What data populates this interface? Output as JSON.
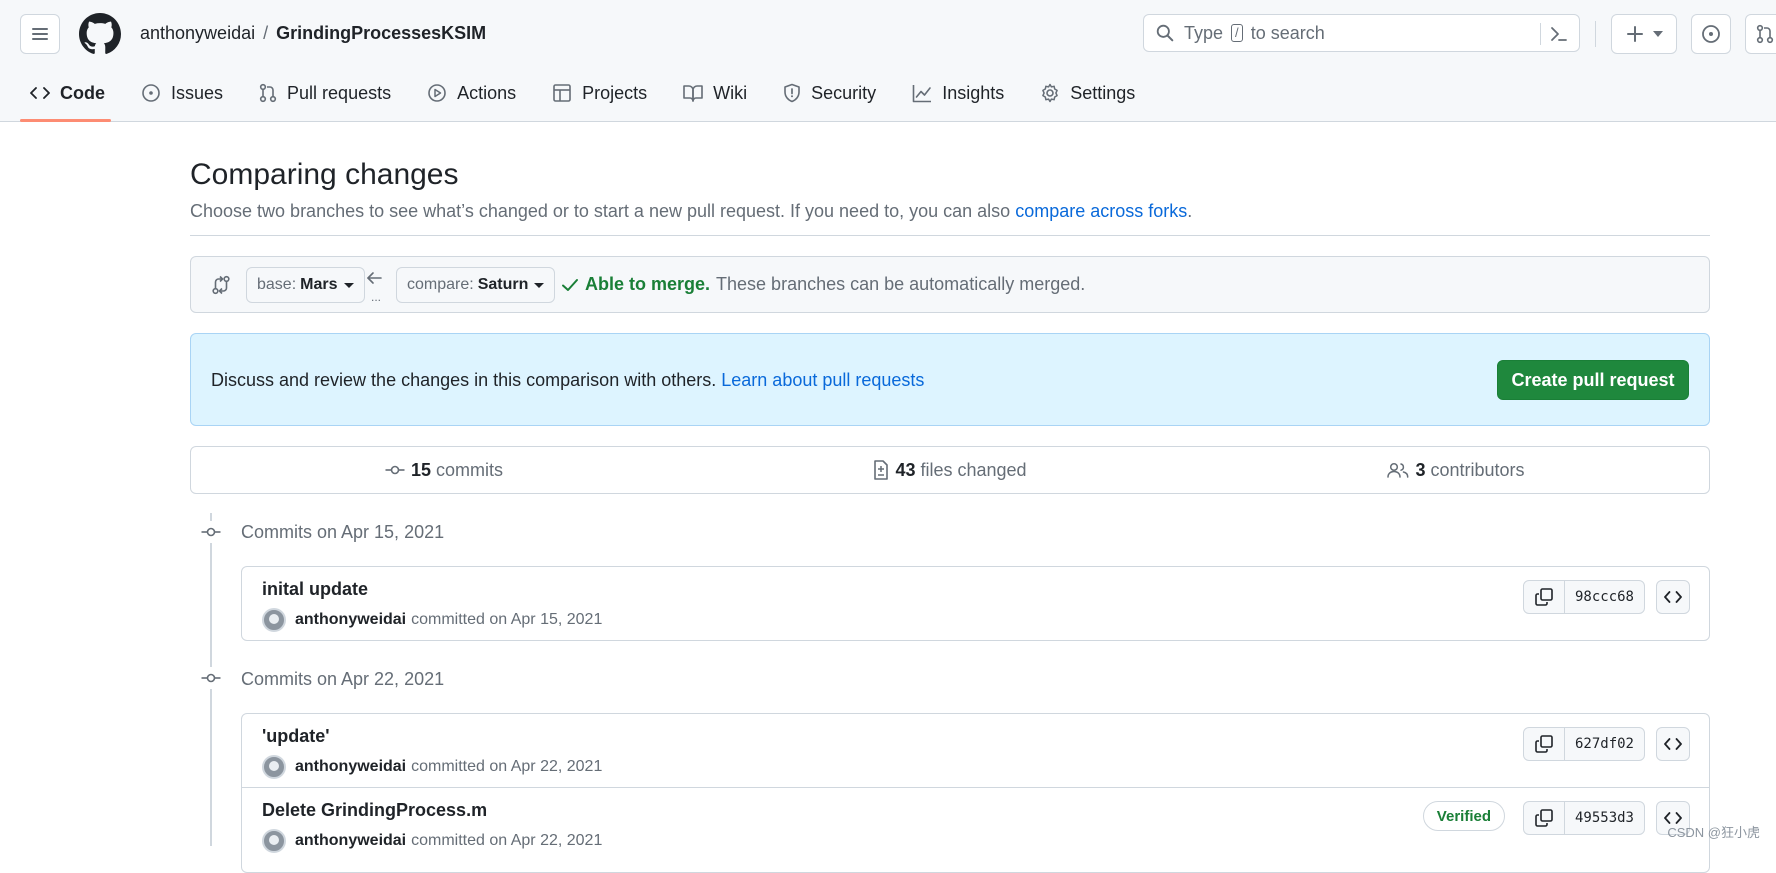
{
  "header": {
    "owner": "anthonyweidai",
    "separator": "/",
    "repo": "GrindingProcessesKSIM",
    "search_prefix": "Type",
    "search_key": "/",
    "search_suffix": "to search"
  },
  "tabs": [
    {
      "label": "Code",
      "icon": "code-icon"
    },
    {
      "label": "Issues",
      "icon": "issue-icon"
    },
    {
      "label": "Pull requests",
      "icon": "pull-request-icon"
    },
    {
      "label": "Actions",
      "icon": "play-icon"
    },
    {
      "label": "Projects",
      "icon": "table-icon"
    },
    {
      "label": "Wiki",
      "icon": "book-icon"
    },
    {
      "label": "Security",
      "icon": "shield-icon"
    },
    {
      "label": "Insights",
      "icon": "graph-icon"
    },
    {
      "label": "Settings",
      "icon": "gear-icon"
    }
  ],
  "page": {
    "title": "Comparing changes",
    "subtitle": "Choose two branches to see what’s changed or to start a new pull request. If you need to, you can also",
    "subtitle_link": "compare across forks",
    "subtitle_end": "."
  },
  "range": {
    "base_prefix": "base:",
    "base_branch": "Mars",
    "compare_prefix": "compare:",
    "compare_branch": "Saturn",
    "dots": "...",
    "merge_status": "Able to merge.",
    "merge_detail": "These branches can be automatically merged."
  },
  "flash": {
    "text": "Discuss and review the changes in this comparison with others.",
    "link": "Learn about pull requests",
    "button": "Create pull request"
  },
  "summary": {
    "commits_count": "15",
    "commits_label": "commits",
    "files_count": "43",
    "files_label": "files changed",
    "contributors_count": "3",
    "contributors_label": "contributors"
  },
  "groups": [
    {
      "title": "Commits on Apr 15, 2021",
      "commits": [
        {
          "message": "inital update",
          "author": "anthonyweidai",
          "date_text": "committed on Apr 15, 2021",
          "sha": "98ccc68",
          "verified": ""
        }
      ]
    },
    {
      "title": "Commits on Apr 22, 2021",
      "commits": [
        {
          "message": "'update'",
          "author": "anthonyweidai",
          "date_text": "committed on Apr 22, 2021",
          "sha": "627df02",
          "verified": ""
        },
        {
          "message": "Delete GrindingProcess.m",
          "author": "anthonyweidai",
          "date_text": "committed on Apr 22, 2021",
          "sha": "49553d3",
          "verified": "Verified"
        }
      ]
    }
  ],
  "watermark": "CSDN @狂小虎",
  "colors": {
    "accent_link": "#0969da",
    "success": "#1a7f37",
    "button_green": "#1f883d",
    "tab_underline": "#fd8c73",
    "flash_bg": "#ddf4ff"
  }
}
